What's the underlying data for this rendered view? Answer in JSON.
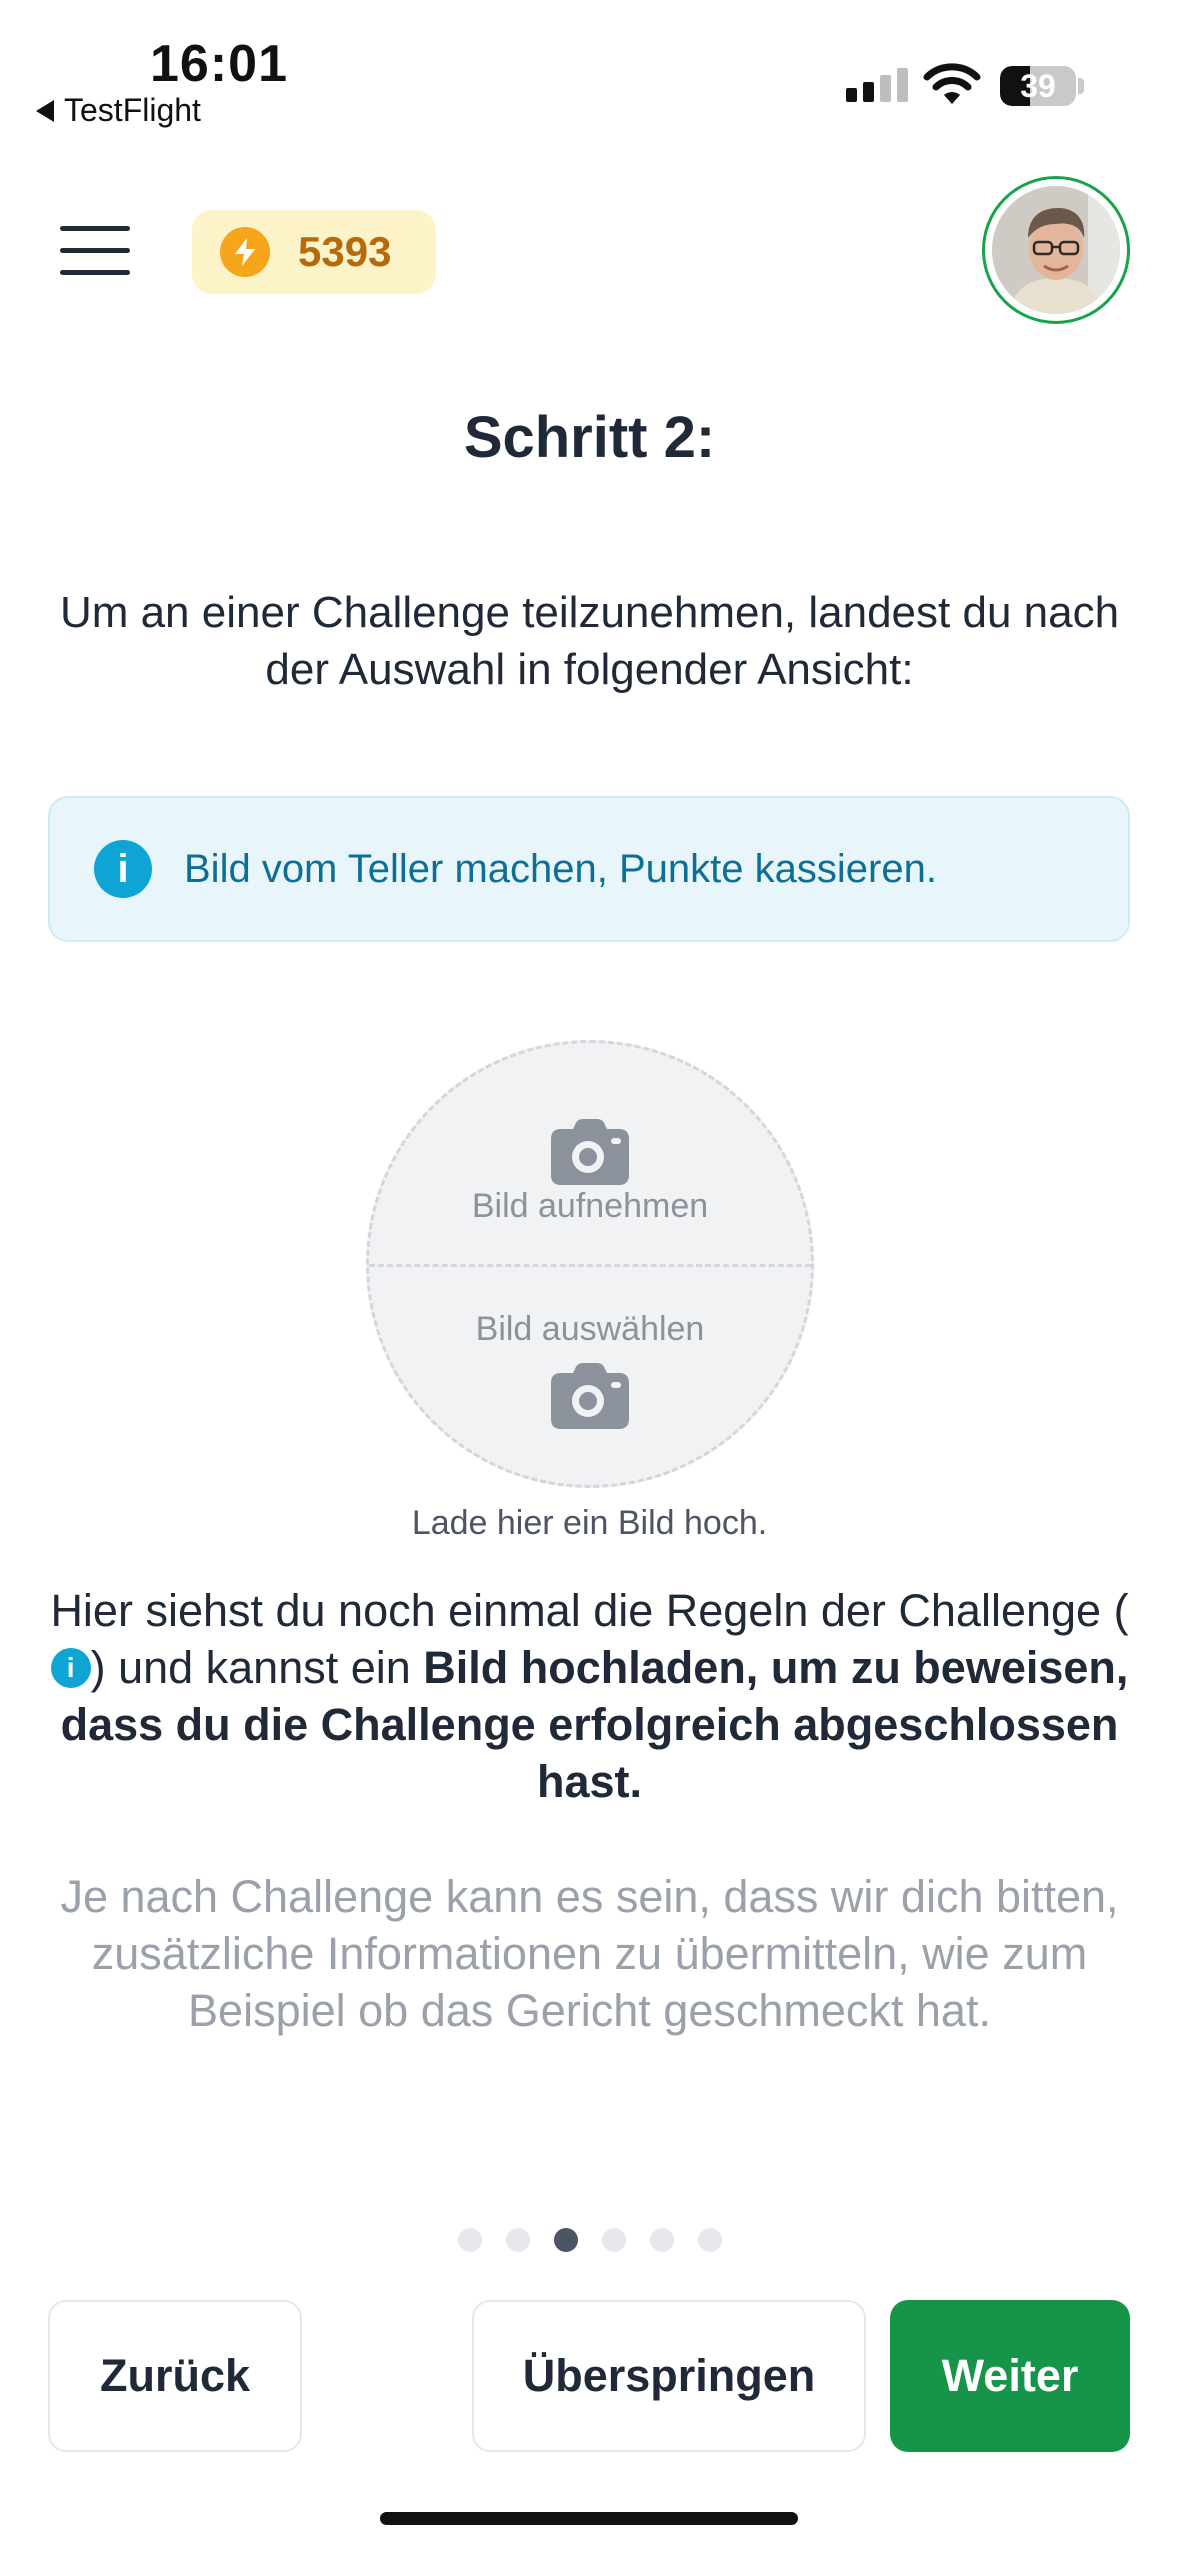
{
  "status_bar": {
    "time": "16:01",
    "back_app": "TestFlight",
    "battery": "39",
    "battery_level": 0.39
  },
  "header": {
    "points": "5393"
  },
  "step": {
    "title": "Schritt 2:",
    "intro": "Um an einer Challenge teilzunehmen, landest du nach der Auswahl in folgender Ansicht:"
  },
  "info_box": {
    "text": "Bild vom Teller machen, Punkte kassieren."
  },
  "upload": {
    "take_label": "Bild aufnehmen",
    "choose_label": "Bild auswählen",
    "hint": "Lade hier ein Bild hoch."
  },
  "rules": {
    "part1": "Hier siehst du noch einmal die Regeln der Challenge (",
    "info_glyph": "i",
    "part2": ") und kannst ein ",
    "bold": "Bild hochladen, um zu beweisen, dass du die Challenge erfolgreich abgeschlossen hast."
  },
  "note": "Je nach Challenge kann es sein, dass wir dich bitten, zusätzliche Informationen zu übermitteln, wie zum Beispiel ob das Gericht geschmeckt hat.",
  "pagination": {
    "total": 6,
    "current": 3
  },
  "buttons": {
    "back": "Zurück",
    "skip": "Überspringen",
    "next": "Weiter"
  },
  "colors": {
    "primary": "#16954a",
    "info": "#0ea5d4",
    "points_bg": "#fdf3c8",
    "points_text": "#b56a0c"
  },
  "icons": [
    "back-arrow-icon",
    "cellular-signal-icon",
    "wifi-icon",
    "battery-icon",
    "menu-icon",
    "lightning-bolt-icon",
    "info-icon",
    "camera-icon"
  ]
}
